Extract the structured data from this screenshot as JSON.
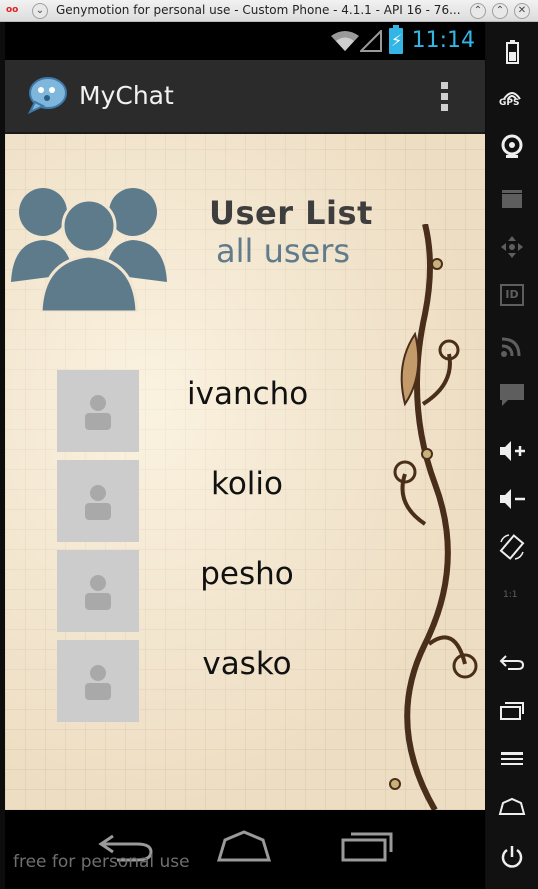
{
  "window": {
    "title": "Genymotion for personal use - Custom Phone - 4.1.1 - API 16 - 76...",
    "icon_text": "oo",
    "controls": [
      "minimize-icon",
      "maximize-icon",
      "close-icon"
    ]
  },
  "statusbar": {
    "time": "11:14",
    "icons": [
      "wifi-icon",
      "signal-icon",
      "battery-charging-icon"
    ]
  },
  "actionbar": {
    "app_title": "MyChat",
    "logo": "chat-bubble-logo-icon",
    "menu_icon": "overflow-menu-icon"
  },
  "header": {
    "title": "User List",
    "subtitle": "all users",
    "icon": "users-group-icon"
  },
  "users": [
    {
      "name": "ivancho",
      "avatar": "default-avatar-icon"
    },
    {
      "name": "kolio",
      "avatar": "default-avatar-icon"
    },
    {
      "name": "pesho",
      "avatar": "default-avatar-icon"
    },
    {
      "name": "vasko",
      "avatar": "default-avatar-icon"
    }
  ],
  "navbar": {
    "watermark": "free for personal use",
    "buttons": [
      "back-icon",
      "home-icon",
      "recent-apps-icon"
    ]
  },
  "toolbar": {
    "items": [
      {
        "icon": "battery-icon",
        "label": ""
      },
      {
        "icon": "gps-icon",
        "label": "GPS"
      },
      {
        "icon": "webcam-icon",
        "label": ""
      },
      {
        "icon": "video-capture-icon",
        "label": ""
      },
      {
        "icon": "dpad-icon",
        "label": ""
      },
      {
        "icon": "device-id-icon",
        "label": "ID"
      },
      {
        "icon": "cast-icon",
        "label": ""
      },
      {
        "icon": "sms-icon",
        "label": ""
      },
      {
        "icon": "volume-up-icon",
        "label": ""
      },
      {
        "icon": "volume-down-icon",
        "label": ""
      },
      {
        "icon": "rotate-icon",
        "label": ""
      },
      {
        "icon": "pixel-perfect-icon",
        "label": "1:1"
      },
      {
        "icon": "back-icon",
        "label": ""
      },
      {
        "icon": "recent-apps-icon",
        "label": ""
      },
      {
        "icon": "menu-icon",
        "label": ""
      },
      {
        "icon": "home-icon",
        "label": ""
      },
      {
        "icon": "power-icon",
        "label": ""
      }
    ]
  },
  "colors": {
    "accent": "#33b5e5",
    "actionbar": "#2b2b2b",
    "users_icon": "#5e7b8c",
    "avatar_bg": "#cccccc"
  }
}
